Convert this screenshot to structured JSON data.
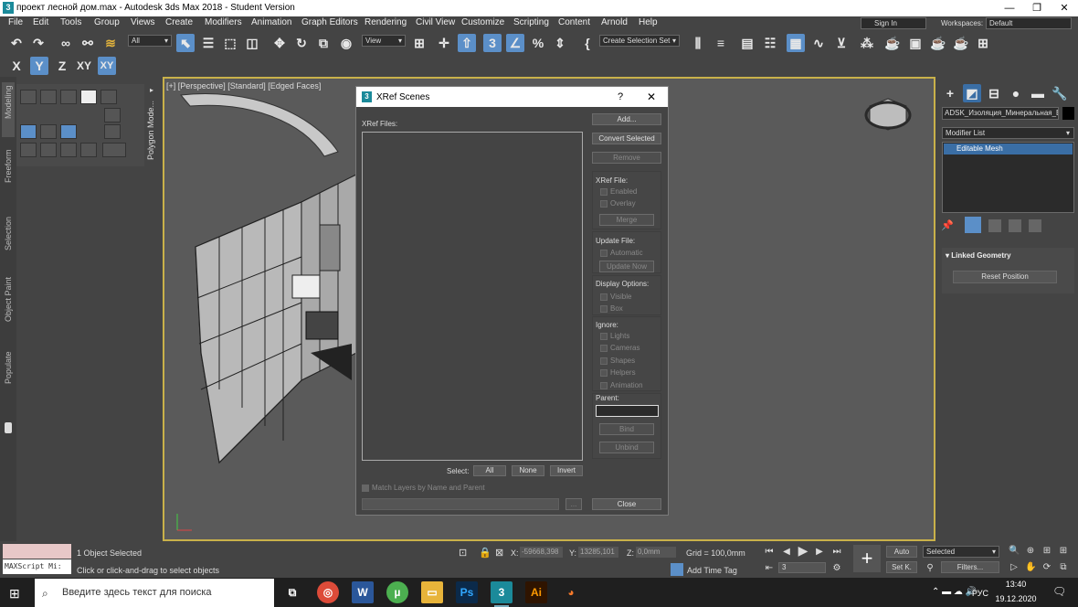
{
  "window": {
    "title": "проект лесной дом.max - Autodesk 3ds Max 2018 - Student Version",
    "minimize": "—",
    "maximize": "❐",
    "close": "✕"
  },
  "menu": [
    "File",
    "Edit",
    "Tools",
    "Group",
    "Views",
    "Create",
    "Modifiers",
    "Animation",
    "Graph Editors",
    "Rendering",
    "Civil View",
    "Customize",
    "Scripting",
    "Content",
    "Arnold",
    "Help"
  ],
  "signin": "Sign In",
  "workspaces": {
    "label": "Workspaces:",
    "value": "Default"
  },
  "toolbar": {
    "filter": "All",
    "view": "View",
    "selection_set": "Create Selection Set"
  },
  "axis_buttons": [
    "X",
    "Y",
    "Z",
    "XY",
    "XY"
  ],
  "ribbon_tabs": [
    "Modeling",
    "Freeform",
    "Selection",
    "Object Paint",
    "Populate"
  ],
  "poly_tab": "Polygon Mode...",
  "viewport": {
    "label": "[+] [Perspective] [Standard] [Edged Faces]"
  },
  "dialog": {
    "title": "XRef Scenes",
    "help": "?",
    "close": "✕",
    "xref_files_label": "XRef Files:",
    "buttons": {
      "add": "Add...",
      "convert": "Convert Selected",
      "remove": "Remove"
    },
    "xref_file": {
      "label": "XRef File:",
      "enabled": "Enabled",
      "overlay": "Overlay",
      "merge": "Merge"
    },
    "update_file": {
      "label": "Update File:",
      "automatic": "Automatic",
      "update_now": "Update Now"
    },
    "display": {
      "label": "Display Options:",
      "visible": "Visible",
      "box": "Box"
    },
    "ignore": {
      "label": "Ignore:",
      "items": [
        "Lights",
        "Cameras",
        "Shapes",
        "Helpers",
        "Animation"
      ]
    },
    "parent": {
      "label": "Parent:",
      "bind": "Bind",
      "unbind": "Unbind"
    },
    "select": {
      "label": "Select:",
      "all": "All",
      "none": "None",
      "invert": "Invert"
    },
    "match_layers": "Match Layers by Name and Parent",
    "browse": "...",
    "close_btn": "Close"
  },
  "right_panel": {
    "object_name": "ADSK_Изоляция_Минеральная_Ва",
    "modifier_list": "Modifier List",
    "stack_item": "Editable Mesh",
    "rollout_title": "Linked Geometry",
    "reset_position": "Reset Position"
  },
  "status": {
    "maxscript": "MAXScript Mi:",
    "selected": "1 Object Selected",
    "prompt": "Click or click-and-drag to select objects",
    "x_label": "X:",
    "x_value": "-59668,398",
    "y_label": "Y:",
    "y_value": "13285,101",
    "z_label": "Z:",
    "z_value": "0,0mm",
    "grid": "Grid = 100,0mm",
    "add_time_tag": "Add Time Tag",
    "frame": "3",
    "auto": "Auto",
    "set_key": "Set K.",
    "selected_mode": "Selected",
    "filters": "Filters..."
  },
  "taskbar": {
    "search_placeholder": "Введите здесь текст для поиска",
    "lang": "РУС",
    "time": "13:40",
    "date": "19.12.2020"
  },
  "colors": {
    "accent": "#5b8fc8",
    "viewport_border": "#c9b14a",
    "stack_selected": "#3a6ea5"
  }
}
